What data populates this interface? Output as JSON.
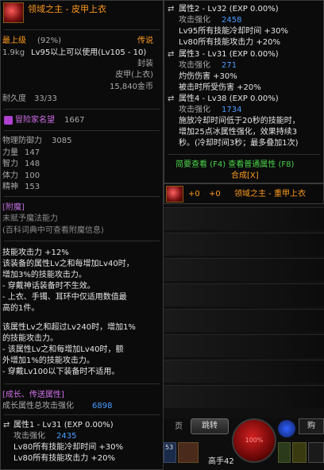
{
  "left_tooltip": {
    "item_name": "领域之主 - 皮甲上衣",
    "level_label": "最上级",
    "level_pct": "(92%)",
    "rarity": "传说",
    "weight": "1.9kg",
    "level_req": "Lv95以上可以使用(Lv105 - 10)",
    "seal": "封装",
    "item_type": "皮甲(上衣)",
    "price": "15,840金币",
    "durability_label": "耐久度",
    "durability_value": "33/33",
    "adventurer_label": "冒险家名望",
    "adventurer_value": "1667",
    "stats": [
      {
        "label": "物理防御力",
        "value": "3085"
      },
      {
        "label": "力量",
        "value": "147"
      },
      {
        "label": "智力",
        "value": "148"
      },
      {
        "label": "体力",
        "value": "100"
      },
      {
        "label": "精神",
        "value": "153"
      }
    ],
    "enchant_header": "[附魔]",
    "enchant_none": "未赋予魔法能力",
    "enchant_hint": "(百科词典中可查看附魔信息)",
    "skill_desc": [
      "技能攻击力 +12%",
      "该装备的属性Lv之和每增加Lv40时，",
      "增加3%的技能攻击力。",
      "- 穿戴神话装备时不生效。",
      "- 上衣、手镯、耳环中仅适用数值最",
      "高的1件。",
      "",
      "该属性Lv之和超过Lv240时，增加1%",
      "的技能攻击力。",
      "- 该属性Lv之和每增加Lv40时，额",
      "外增加1%的技能攻击力。",
      "- 穿戴Lv100以下装备时不适用。"
    ],
    "growth_header": "[成长、传送属性]",
    "growth_total_label": "成长属性总攻击强化",
    "growth_total_value": "6898",
    "attr1_title": "属性1 - Lv31 (EXP 0.00%)",
    "attr1_atk_label": "攻击强化",
    "attr1_atk_value": "2435",
    "attr1_lines": [
      "Lv80所有技能冷却时间 +30%",
      "Lv80所有技能攻击力 +20%"
    ]
  },
  "right_tooltip": {
    "attr2_title": "属性2 - Lv32 (EXP 0.00%)",
    "attr2_atk_label": "攻击强化",
    "attr2_atk_value": "2458",
    "attr2_lines": [
      "Lv95所有技能冷却时间 +30%",
      "Lv80所有技能攻击力 +20%"
    ],
    "attr3_title": "属性3 - Lv31 (EXP 0.00%)",
    "attr3_atk_label": "攻击强化",
    "attr3_atk_value": "271",
    "attr3_lines": [
      "灼伤伤害 +30%",
      "被击时所受伤害 +20%"
    ],
    "attr4_title": "属性4 - Lv38 (EXP 0.00%)",
    "attr4_atk_label": "攻击强化",
    "attr4_atk_value": "1734",
    "attr4_lines": [
      "施放冷却时间低于20秒的技能时，",
      "增加25点冰属性强化，效果持续3",
      "秒。(冷却时间3秒；最多叠加1次)"
    ],
    "footer_line1": "简要查看 (F4) 查看普通属性 (F8)",
    "footer_line2": "合成[X]"
  },
  "compare_header": {
    "plus_a": "+0",
    "plus_b": "+0",
    "item_name": "领域之主 - 重甲上衣"
  },
  "bottom_bar": {
    "page_label": "页",
    "jump_button": "跳转",
    "orb_label": "100%",
    "slot_count": "53",
    "bottom_text": "高手42"
  }
}
